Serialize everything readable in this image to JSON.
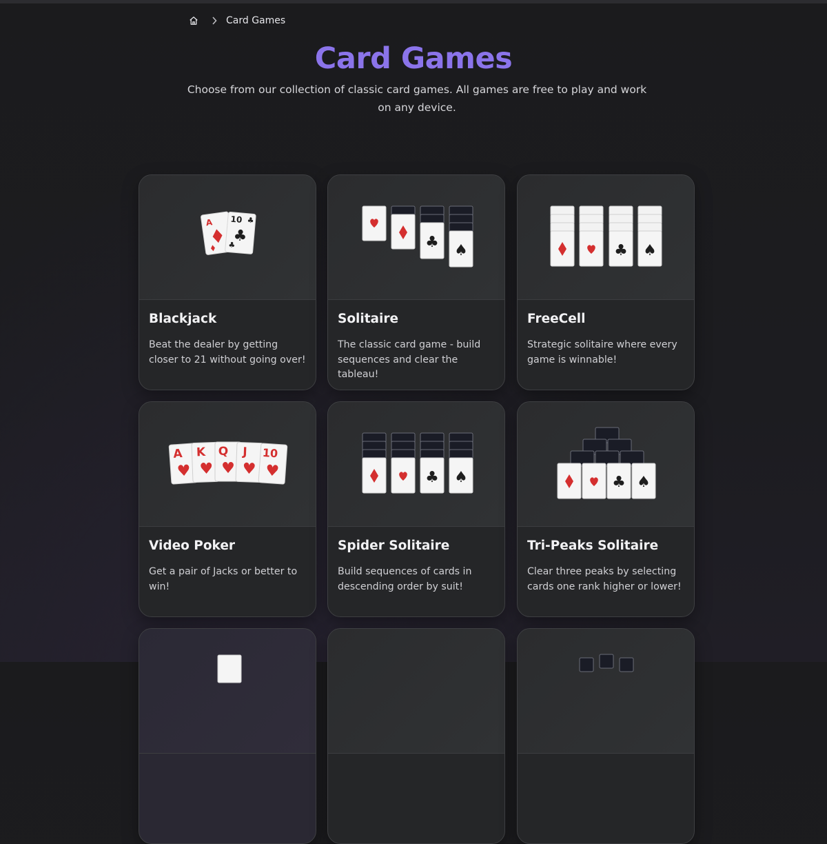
{
  "breadcrumb": {
    "current": "Card Games"
  },
  "page": {
    "title": "Card Games",
    "subtitle": "Choose from our collection of classic card games. All games are free to play and work on any device."
  },
  "games": [
    {
      "title": "Blackjack",
      "description": "Beat the dealer by getting closer to 21 without going over!",
      "image_icon": "blackjack-cards-icon"
    },
    {
      "title": "Solitaire",
      "description": "The classic card game - build sequences and clear the tableau!",
      "image_icon": "solitaire-tableau-icon"
    },
    {
      "title": "FreeCell",
      "description": "Strategic solitaire where every game is winnable!",
      "image_icon": "freecell-columns-icon"
    },
    {
      "title": "Video Poker",
      "description": "Get a pair of Jacks or better to win!",
      "image_icon": "poker-royal-flush-icon"
    },
    {
      "title": "Spider Solitaire",
      "description": "Build sequences of cards in descending order by suit!",
      "image_icon": "spider-columns-icon"
    },
    {
      "title": "Tri-Peaks Solitaire",
      "description": "Clear three peaks by selecting cards one rank higher or lower!",
      "image_icon": "tripeaks-pyramid-icon"
    }
  ],
  "card_labels": {
    "blackjack": [
      "A",
      "10"
    ],
    "poker": [
      "A",
      "K",
      "Q",
      "J",
      "10"
    ]
  },
  "colors": {
    "accent": "#8b74ea",
    "red_suit": "#d42f2f",
    "black_suit": "#1e1e1e",
    "card_back": "#1a1c26"
  }
}
